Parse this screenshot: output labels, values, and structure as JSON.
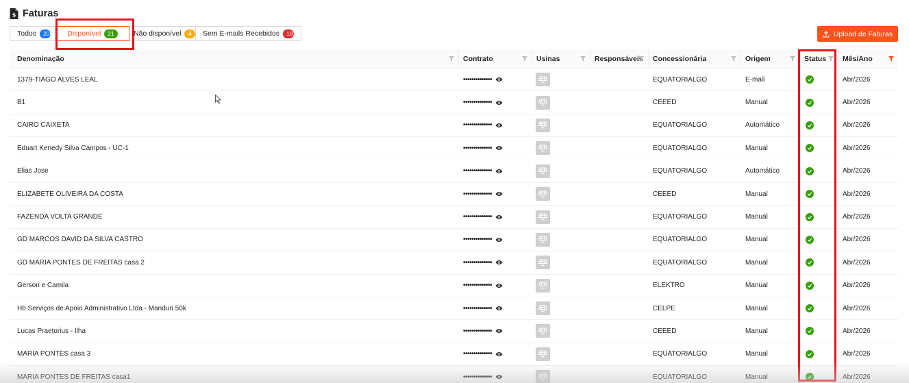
{
  "page": {
    "title": "Faturas",
    "icon": "document-dollar-icon"
  },
  "tabs": [
    {
      "label": "Todos",
      "count": "206",
      "badge_color": "#1677ff",
      "active": false
    },
    {
      "label": "Disponível",
      "count": "21",
      "badge_color": "#389e0d",
      "active": true
    },
    {
      "label": "Não disponível",
      "count": "4",
      "badge_color": "#faad14",
      "active": false
    },
    {
      "label": "Sem E-mails Recebidos",
      "count": "181",
      "badge_color": "#e0282e",
      "active": false
    }
  ],
  "upload_button": {
    "label": "Upload de Faturas",
    "icon": "upload-icon",
    "color": "#fa541c"
  },
  "table": {
    "columns": [
      "Denominação",
      "Contrato",
      "Usinas",
      "Responsáveis",
      "Concessionária",
      "Origem",
      "Status",
      "Mês/Ano"
    ],
    "contract_mask": "••••••••••••••",
    "rows": [
      {
        "denominacao": "1379-TIAGO ALVES LEAL",
        "concessionaria": "EQUATORIALGO",
        "origem": "E-mail",
        "status": "ok",
        "mes_ano": "Abr/2026"
      },
      {
        "denominacao": "B1",
        "concessionaria": "CEEED",
        "origem": "Manual",
        "status": "ok",
        "mes_ano": "Abr/2026"
      },
      {
        "denominacao": "CAIRO CAIXETA",
        "concessionaria": "EQUATORIALGO",
        "origem": "Automático",
        "status": "ok",
        "mes_ano": "Abr/2026"
      },
      {
        "denominacao": "Eduart Kenedy Silva Campos - UC-1",
        "concessionaria": "EQUATORIALGO",
        "origem": "Manual",
        "status": "ok",
        "mes_ano": "Abr/2026"
      },
      {
        "denominacao": "Elias Jose",
        "concessionaria": "EQUATORIALGO",
        "origem": "Automático",
        "status": "ok",
        "mes_ano": "Abr/2026"
      },
      {
        "denominacao": "ELIZABETE OLIVEIRA DA COSTA",
        "concessionaria": "CEEED",
        "origem": "Manual",
        "status": "ok",
        "mes_ano": "Abr/2026"
      },
      {
        "denominacao": "FAZENDA VOLTA GRANDE",
        "concessionaria": "EQUATORIALGO",
        "origem": "Manual",
        "status": "ok",
        "mes_ano": "Abr/2026"
      },
      {
        "denominacao": "GD MARCOS DAVID DA SILVA CASTRO",
        "concessionaria": "EQUATORIALGO",
        "origem": "Manual",
        "status": "ok",
        "mes_ano": "Abr/2026"
      },
      {
        "denominacao": "GD MARIA PONTES DE FREITAS casa 2",
        "concessionaria": "EQUATORIALGO",
        "origem": "Manual",
        "status": "ok",
        "mes_ano": "Abr/2026"
      },
      {
        "denominacao": "Gerson e Camila",
        "concessionaria": "ELEKTRO",
        "origem": "Manual",
        "status": "ok",
        "mes_ano": "Abr/2026"
      },
      {
        "denominacao": "Hb Serviços de Apoio Administrativo Ltda - Manduri 50k",
        "concessionaria": "CELPE",
        "origem": "Manual",
        "status": "ok",
        "mes_ano": "Abr/2026"
      },
      {
        "denominacao": "Lucas Praetorius - Ilha",
        "concessionaria": "CEEED",
        "origem": "Manual",
        "status": "ok",
        "mes_ano": "Abr/2026"
      },
      {
        "denominacao": "MARIA PONTES casa 3",
        "concessionaria": "EQUATORIALGO",
        "origem": "Manual",
        "status": "ok",
        "mes_ano": "Abr/2026"
      },
      {
        "denominacao": "MARIA PONTES DE FREITAS casa1",
        "concessionaria": "EQUATORIALGO",
        "origem": "Manual",
        "status": "ok",
        "mes_ano": "Abr/2026"
      }
    ]
  },
  "colors": {
    "accent": "#fa541c",
    "highlight": "#e8131c",
    "status_ok": "#389e0d",
    "sorted_filter": "#fa541c",
    "filter": "#bfbfbf"
  }
}
